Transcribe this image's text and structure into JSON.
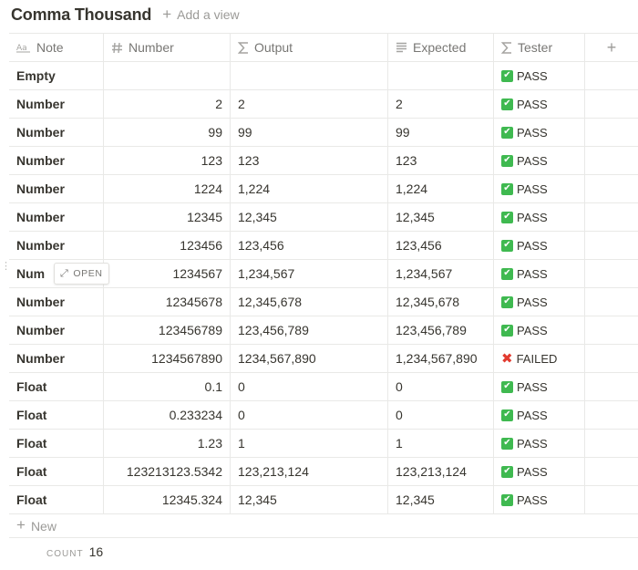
{
  "header": {
    "title": "Comma Thousand",
    "add_view_label": "Add a view"
  },
  "columns": {
    "note": {
      "label": "Note",
      "icon": "text-icon"
    },
    "number": {
      "label": "Number",
      "icon": "hash-icon"
    },
    "output": {
      "label": "Output",
      "icon": "sigma-icon"
    },
    "expected": {
      "label": "Expected",
      "icon": "lines-icon"
    },
    "tester": {
      "label": "Tester",
      "icon": "sigma-icon"
    },
    "add": {
      "label": "+"
    }
  },
  "rows": [
    {
      "note": "Empty",
      "number": "",
      "output": "",
      "expected": "",
      "status": "PASS",
      "status_icon": "check-icon"
    },
    {
      "note": "Number",
      "number": "2",
      "output": "2",
      "expected": "2",
      "status": "PASS",
      "status_icon": "check-icon"
    },
    {
      "note": "Number",
      "number": "99",
      "output": "99",
      "expected": "99",
      "status": "PASS",
      "status_icon": "check-icon"
    },
    {
      "note": "Number",
      "number": "123",
      "output": "123",
      "expected": "123",
      "status": "PASS",
      "status_icon": "check-icon"
    },
    {
      "note": "Number",
      "number": "1224",
      "output": "1,224",
      "expected": "1,224",
      "status": "PASS",
      "status_icon": "check-icon"
    },
    {
      "note": "Number",
      "number": "12345",
      "output": "12,345",
      "expected": "12,345",
      "status": "PASS",
      "status_icon": "check-icon"
    },
    {
      "note": "Number",
      "number": "123456",
      "output": "123,456",
      "expected": "123,456",
      "status": "PASS",
      "status_icon": "check-icon"
    },
    {
      "note": "Num",
      "number": "1234567",
      "output": "1,234,567",
      "expected": "1,234,567",
      "status": "PASS",
      "status_icon": "check-icon",
      "open_label": "OPEN"
    },
    {
      "note": "Number",
      "number": "12345678",
      "output": "12,345,678",
      "expected": "12,345,678",
      "status": "PASS",
      "status_icon": "check-icon"
    },
    {
      "note": "Number",
      "number": "123456789",
      "output": "123,456,789",
      "expected": "123,456,789",
      "status": "PASS",
      "status_icon": "check-icon"
    },
    {
      "note": "Number",
      "number": "1234567890",
      "output": "1234,567,890",
      "expected": "1,234,567,890",
      "status": "FAILED",
      "status_icon": "cross-icon"
    },
    {
      "note": "Float",
      "number": "0.1",
      "output": "0",
      "expected": "0",
      "status": "PASS",
      "status_icon": "check-icon"
    },
    {
      "note": "Float",
      "number": "0.233234",
      "output": "0",
      "expected": "0",
      "status": "PASS",
      "status_icon": "check-icon"
    },
    {
      "note": "Float",
      "number": "1.23",
      "output": "1",
      "expected": "1",
      "status": "PASS",
      "status_icon": "check-icon"
    },
    {
      "note": "Float",
      "number": "123213123.5342",
      "output": "123,213,124",
      "expected": "123,213,124",
      "status": "PASS",
      "status_icon": "check-icon"
    },
    {
      "note": "Float",
      "number": "12345.324",
      "output": "12,345",
      "expected": "12,345",
      "status": "PASS",
      "status_icon": "check-icon"
    }
  ],
  "new_row_label": "New",
  "footer": {
    "count_label": "COUNT",
    "count_value": "16"
  },
  "colors": {
    "pass": "#3fb950",
    "fail": "#e23b30",
    "border": "#e9e9e7",
    "muted": "#9b9a97",
    "text": "#37352f"
  }
}
